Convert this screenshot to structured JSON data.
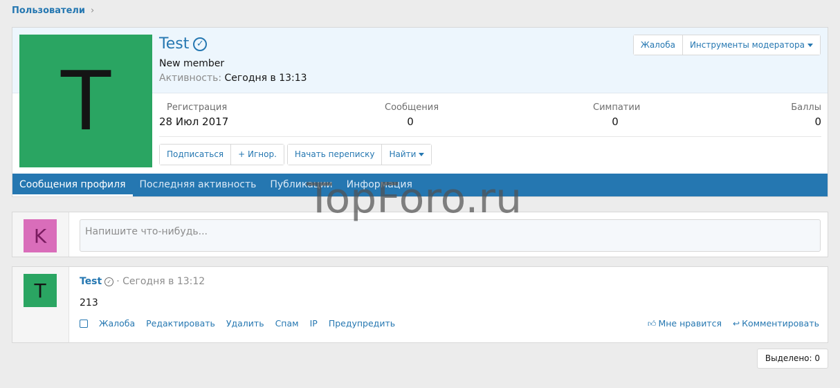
{
  "breadcrumb": {
    "label": "Пользователи",
    "chevron": "›"
  },
  "profile": {
    "avatar_letter": "T",
    "avatar_color": "#2aa562",
    "username": "Test",
    "verified_icon": "✓",
    "user_title": "New member",
    "activity_label": "Активность:",
    "activity_value": "Сегодня в 13:13",
    "report_label": "Жалоба",
    "moderator_tools_label": "Инструменты модератора",
    "stats": {
      "registration_label": "Регистрация",
      "registration_value": "28 Июл 2017",
      "messages_label": "Сообщения",
      "messages_value": "0",
      "likes_label": "Симпатии",
      "likes_value": "0",
      "points_label": "Баллы",
      "points_value": "0"
    },
    "actions": {
      "follow_label": "Подписаться",
      "ignore_label": "+ Игнор.",
      "start_conversation_label": "Начать переписку",
      "find_label": "Найти"
    },
    "tabs": [
      {
        "label": "Сообщения профиля"
      },
      {
        "label": "Последняя активность"
      },
      {
        "label": "Публикации"
      },
      {
        "label": "Информация"
      }
    ]
  },
  "post_box": {
    "avatar_letter": "K",
    "avatar_color": "#d96dba",
    "placeholder": "Напишите что-нибудь..."
  },
  "message": {
    "avatar_letter": "T",
    "author": "Test",
    "verified_icon": "✓",
    "time": "· Сегодня в 13:12",
    "body": "213",
    "actions": [
      "Жалоба",
      "Редактировать",
      "Удалить",
      "Спам",
      "IP",
      "Предупредить"
    ],
    "like_label": "Мне нравится",
    "comment_label": "Комментировать"
  },
  "selected_label": "Выделено: 0",
  "watermark": "TopForo.ru",
  "colors": {
    "accent": "#2577b1",
    "tab_bar": "#2577b1"
  }
}
